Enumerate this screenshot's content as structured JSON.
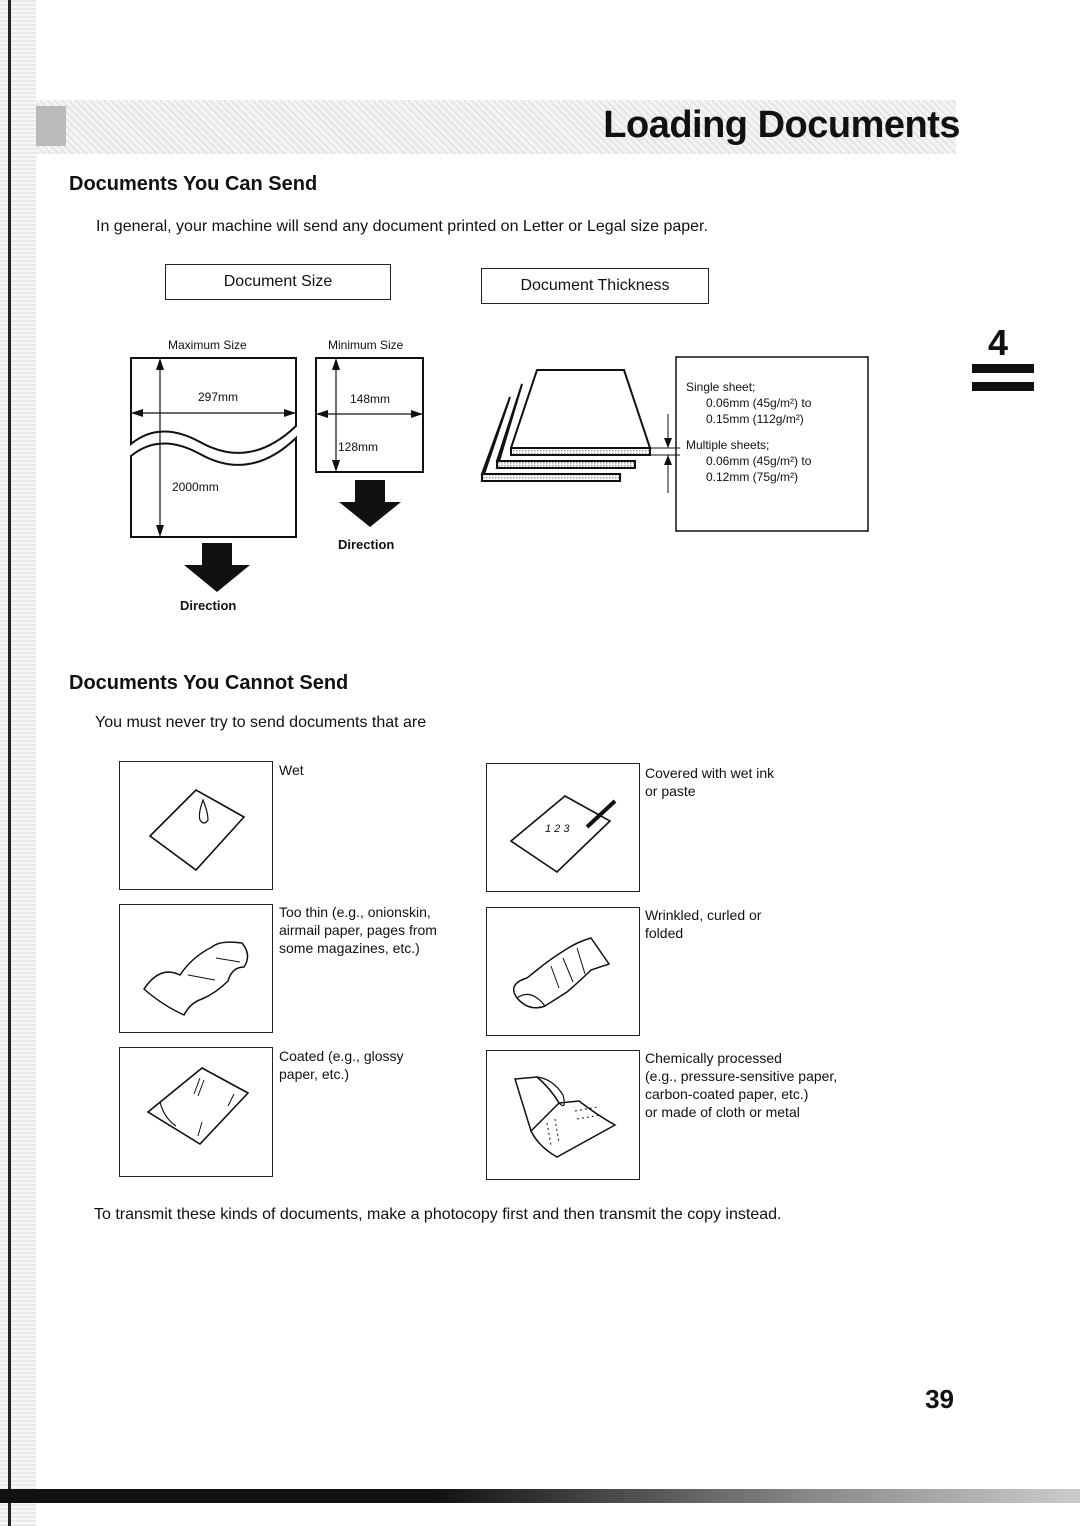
{
  "page": {
    "title": "Loading Documents",
    "chapter_number": "4",
    "page_number": "39"
  },
  "can_send": {
    "heading": "Documents You Can Send",
    "intro": "In general, your machine will send any document printed on Letter or Legal size paper.",
    "size_box_label": "Document Size",
    "thickness_box_label": "Document Thickness",
    "max_size": {
      "label": "Maximum Size",
      "width": "297mm",
      "length": "2000mm",
      "direction_label": "Direction"
    },
    "min_size": {
      "label": "Minimum Size",
      "width": "148mm",
      "length": "128mm",
      "direction_label": "Direction"
    },
    "thickness": {
      "single_label": "Single sheet;",
      "single_min": "0.06mm (45g/m²) to",
      "single_max": "0.15mm (112g/m²)",
      "multi_label": "Multiple sheets;",
      "multi_min": "0.06mm (45g/m²) to",
      "multi_max": "0.12mm (75g/m²)"
    }
  },
  "cannot_send": {
    "heading": "Documents You Cannot Send",
    "intro": "You must never try to send documents that are",
    "items": [
      {
        "icon": "wet-paper-icon",
        "lines": [
          "Wet"
        ]
      },
      {
        "icon": "ink-pen-paper-icon",
        "lines": [
          "Covered with wet ink",
          "or paste"
        ]
      },
      {
        "icon": "thin-paper-icon",
        "lines": [
          "Too thin (e.g., onionskin,",
          "airmail paper, pages from",
          "some magazines, etc.)"
        ]
      },
      {
        "icon": "wrinkled-paper-icon",
        "lines": [
          "Wrinkled, curled or",
          "folded"
        ]
      },
      {
        "icon": "glossy-paper-icon",
        "lines": [
          "Coated (e.g., glossy",
          "paper, etc.)"
        ]
      },
      {
        "icon": "carbon-paper-icon",
        "lines": [
          "Chemically processed",
          "(e.g., pressure-sensitive paper,",
          "carbon-coated paper, etc.)",
          "or made of cloth or metal"
        ]
      }
    ],
    "footer_note": "To transmit these kinds of documents, make a photocopy first and then transmit the copy instead.",
    "item1_sample_digits": "1 2 3"
  }
}
